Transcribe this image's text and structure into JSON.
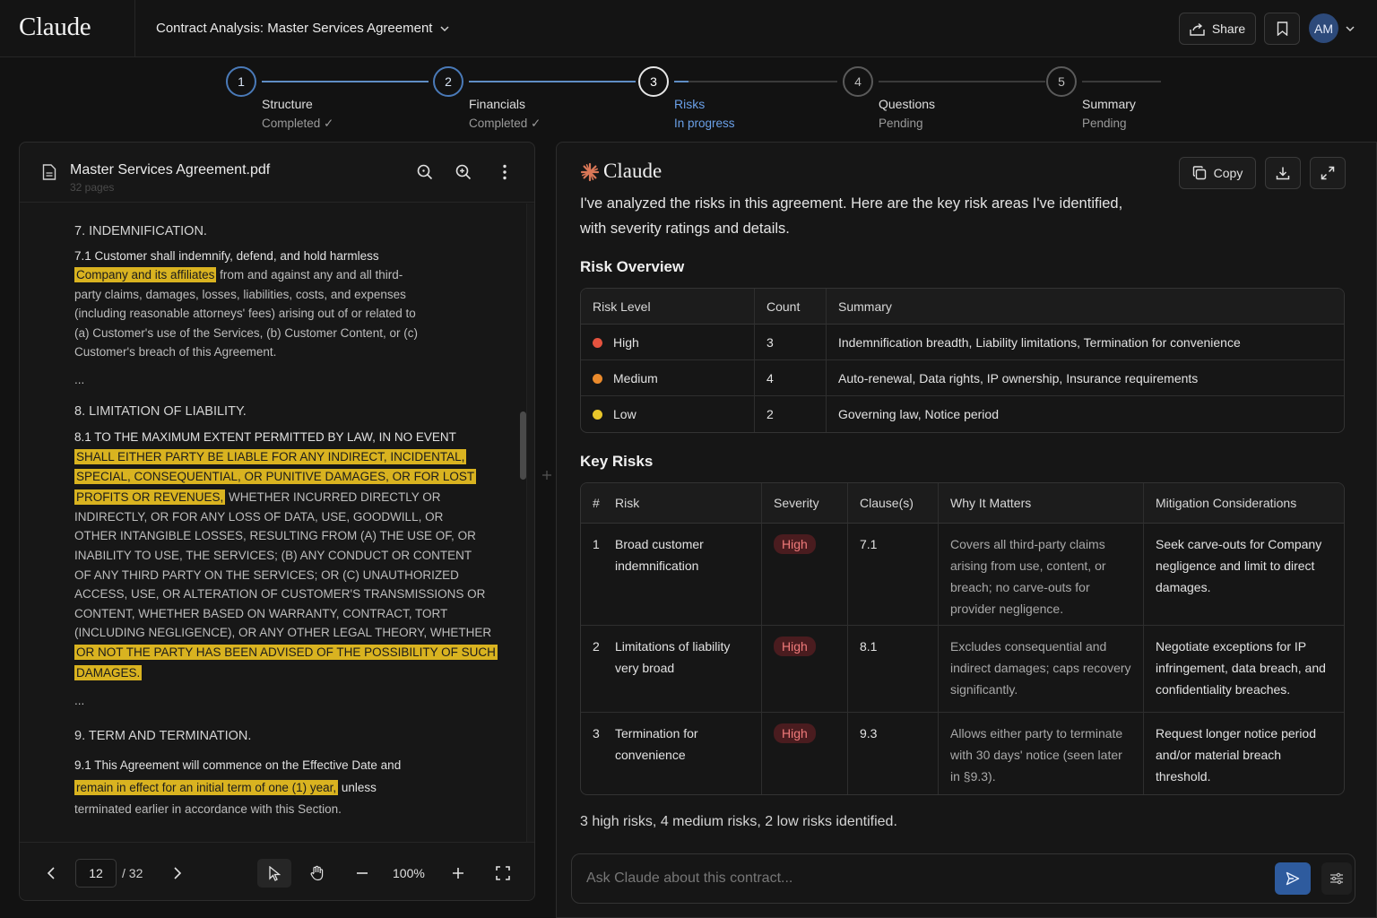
{
  "app": {
    "logo": "Claude"
  },
  "header": {
    "title": "Contract Analysis: Master Services Agreement",
    "share_label": "Share",
    "avatar_initials": "AM"
  },
  "stepper": {
    "steps": [
      {
        "number": "1",
        "name": "Structure",
        "status": "Completed ✓",
        "state": "completed"
      },
      {
        "number": "2",
        "name": "Financials",
        "status": "Completed ✓",
        "state": "completed"
      },
      {
        "number": "3",
        "name": "Risks",
        "status": "In progress",
        "state": "active"
      },
      {
        "number": "4",
        "name": "Questions",
        "status": "Pending",
        "state": "pending"
      },
      {
        "number": "5",
        "name": "Summary",
        "status": "Pending",
        "state": "pending"
      }
    ]
  },
  "document": {
    "filename": "Master Services Agreement.pdf",
    "pages_label": "32 pages",
    "s7_heading": "7. INDEMNIFICATION.",
    "s7_1_a": "7.1 Customer shall indemnify, defend, and hold harmless",
    "s7_1_hl": "Company and its affiliates",
    "s7_1_b": "from and against any and all third-",
    "s7_1_c": "party claims, damages, losses, liabilities, costs, and expenses",
    "s7_1_d": "(including reasonable attorneys' fees) arising out of or related to",
    "s7_1_e": "(a) Customer's use of the Services, (b) Customer Content, or (c)",
    "s7_1_f": "Customer's breach of this Agreement.",
    "ellipsis": "...",
    "s8_heading": "8. LIMITATION OF LIABILITY.",
    "s8_1_a": "8.1 TO THE MAXIMUM EXTENT PERMITTED BY LAW, IN NO EVENT",
    "s8_1_hl1": "SHALL EITHER PARTY BE LIABLE FOR ANY INDIRECT, INCIDENTAL,",
    "s8_1_hl2": "SPECIAL, CONSEQUENTIAL, OR PUNITIVE DAMAGES, OR FOR LOST",
    "s8_1_hl3": "PROFITS OR REVENUES,",
    "s8_1_b": "WHETHER INCURRED DIRECTLY OR",
    "s8_1_c": "INDIRECTLY, OR FOR ANY LOSS OF DATA, USE, GOODWILL, OR",
    "s8_1_d": "OTHER INTANGIBLE LOSSES, RESULTING FROM (A) THE USE OF, OR",
    "s8_1_e": "INABILITY TO USE, THE SERVICES; (B) ANY CONDUCT OR CONTENT",
    "s8_1_f": "OF ANY THIRD PARTY ON THE SERVICES; OR (C) UNAUTHORIZED",
    "s8_1_g": "ACCESS, USE, OR ALTERATION OF CUSTOMER'S TRANSMISSIONS OR",
    "s8_1_h": "CONTENT, WHETHER BASED ON WARRANTY, CONTRACT, TORT",
    "s8_1_i": "(INCLUDING NEGLIGENCE), OR ANY OTHER LEGAL THEORY, WHETHER",
    "s8_1_hl4": "OR NOT THE PARTY HAS BEEN ADVISED OF THE POSSIBILITY OF SUCH",
    "s8_1_hl5": "DAMAGES.",
    "s9_heading": "9. TERM AND TERMINATION.",
    "s9_1_a": "9.1 This Agreement will commence on the Effective Date and",
    "s9_1_hl": "remain in effect for an initial term of one (1) year,",
    "s9_1_b": "unless",
    "s9_1_c": "terminated earlier in accordance with this Section."
  },
  "viewer": {
    "current_page": "12",
    "total_pages": "/ 32",
    "zoom": "100%"
  },
  "assistant": {
    "name": "Claude",
    "copy_label": "Copy",
    "intro": "I've analyzed the risks in this agreement. Here are the key risk areas I've identified, with severity ratings and details.",
    "overview_title": "Risk Overview",
    "overview_headers": [
      "Risk Level",
      "Count",
      "Summary"
    ],
    "overview_rows": [
      {
        "level": "High",
        "count": "3",
        "summary": "Indemnification breadth, Liability limitations, Termination for convenience",
        "color": "#e5533f"
      },
      {
        "level": "Medium",
        "count": "4",
        "summary": "Auto-renewal, Data rights, IP ownership, Insurance requirements",
        "color": "#ea8a2c"
      },
      {
        "level": "Low",
        "count": "2",
        "summary": "Governing law, Notice period",
        "color": "#e8c62a"
      }
    ],
    "key_title": "Key Risks",
    "key_headers": [
      "#",
      "Risk",
      "Severity",
      "Clause(s)",
      "Why It Matters",
      "Mitigation Considerations"
    ],
    "key_rows": [
      {
        "num": "1",
        "risk": "Broad customer indemnification",
        "severity": "High",
        "clause": "7.1",
        "why": "Covers all third-party claims arising from use, content, or breach; no carve-outs for provider negligence.",
        "mitigation": "Seek carve-outs for Company negligence and limit to direct damages."
      },
      {
        "num": "2",
        "risk": "Limitations of liability very broad",
        "severity": "High",
        "clause": "8.1",
        "why": "Excludes consequential and indirect damages; caps recovery significantly.",
        "mitigation": "Negotiate exceptions for IP infringement, data breach, and confidentiality breaches."
      },
      {
        "num": "3",
        "risk": "Termination for convenience",
        "severity": "High",
        "clause": "9.3",
        "why": "Allows either party to terminate with 30 days' notice (seen later in §9.3).",
        "mitigation": "Request longer notice period and/or material breach threshold."
      }
    ],
    "summary": "3 high risks, 4 medium risks, 2 low risks identified."
  },
  "chat": {
    "placeholder": "Ask Claude about this contract..."
  }
}
